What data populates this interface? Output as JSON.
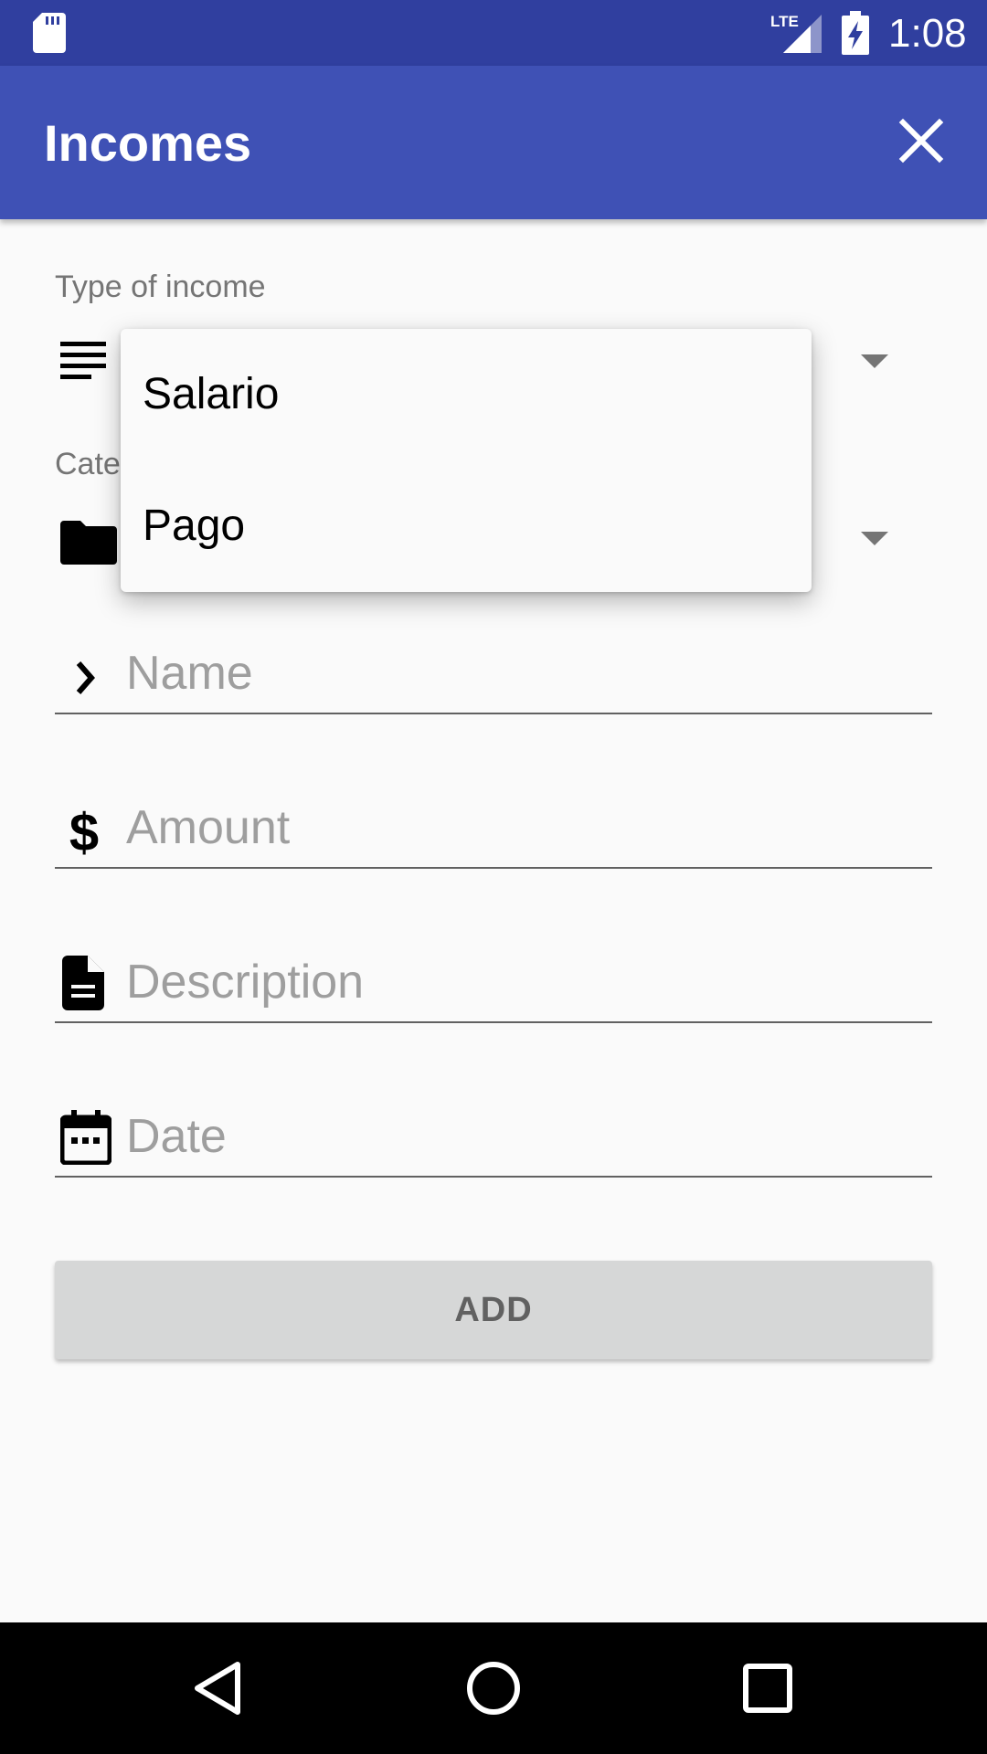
{
  "status_bar": {
    "time": "1:08",
    "network_label": "LTE",
    "icons": [
      "sd-card-icon",
      "lte-signal-icon",
      "battery-charging-icon"
    ]
  },
  "app_bar": {
    "title": "Incomes",
    "close_icon": "close-icon"
  },
  "form": {
    "type_of_income": {
      "label": "Type of income",
      "icon": "subject-icon"
    },
    "category": {
      "label": "Category",
      "visible_label": "Cate",
      "icon": "folder-icon"
    },
    "name": {
      "placeholder": "Name",
      "value": "",
      "icon": "chevron-right-icon"
    },
    "amount": {
      "placeholder": "Amount",
      "value": "",
      "icon": "dollar-icon"
    },
    "description": {
      "placeholder": "Description",
      "value": "",
      "icon": "document-icon"
    },
    "date": {
      "placeholder": "Date",
      "value": "",
      "icon": "calendar-icon"
    },
    "add_label": "ADD"
  },
  "dropdown": {
    "options": [
      "Salario",
      "Pago"
    ]
  },
  "nav_bar": {
    "icons": [
      "back-icon",
      "home-icon",
      "recents-icon"
    ]
  },
  "colors": {
    "status_bar": "#303f9f",
    "app_bar": "#3f51b5",
    "background": "#fafafa",
    "button": "#d6d7d7",
    "hint": "#9e9e9e"
  }
}
